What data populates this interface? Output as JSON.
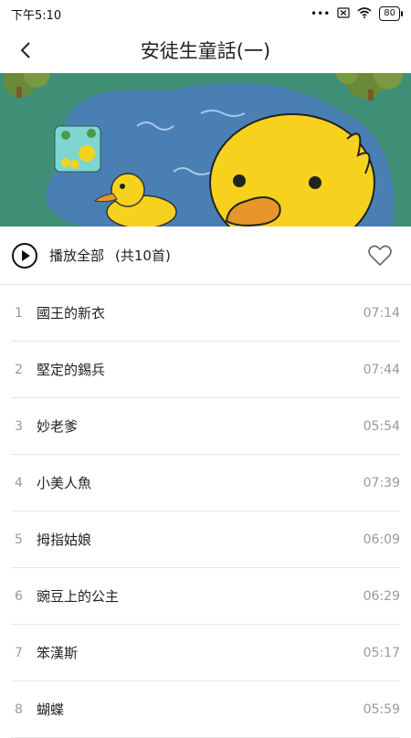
{
  "status": {
    "time": "下午5:10",
    "battery": "80",
    "dots": "•••"
  },
  "header": {
    "title": "安徒生童話(一)"
  },
  "play_all": {
    "label": "播放全部",
    "count": "(共10首)"
  },
  "tracks": [
    {
      "num": "1",
      "title": "國王的新衣",
      "duration": "07:14"
    },
    {
      "num": "2",
      "title": "堅定的錫兵",
      "duration": "07:44"
    },
    {
      "num": "3",
      "title": "妙老爹",
      "duration": "05:54"
    },
    {
      "num": "4",
      "title": "小美人魚",
      "duration": "07:39"
    },
    {
      "num": "5",
      "title": "拇指姑娘",
      "duration": "06:09"
    },
    {
      "num": "6",
      "title": "豌豆上的公主",
      "duration": "06:29"
    },
    {
      "num": "7",
      "title": "笨漢斯",
      "duration": "05:17"
    },
    {
      "num": "8",
      "title": "蝴蝶",
      "duration": "05:59"
    }
  ],
  "colors": {
    "banner_bg": "#3f8f77",
    "pond": "#4a7fb3",
    "duck": "#f6d21e",
    "beak": "#e8962a"
  }
}
